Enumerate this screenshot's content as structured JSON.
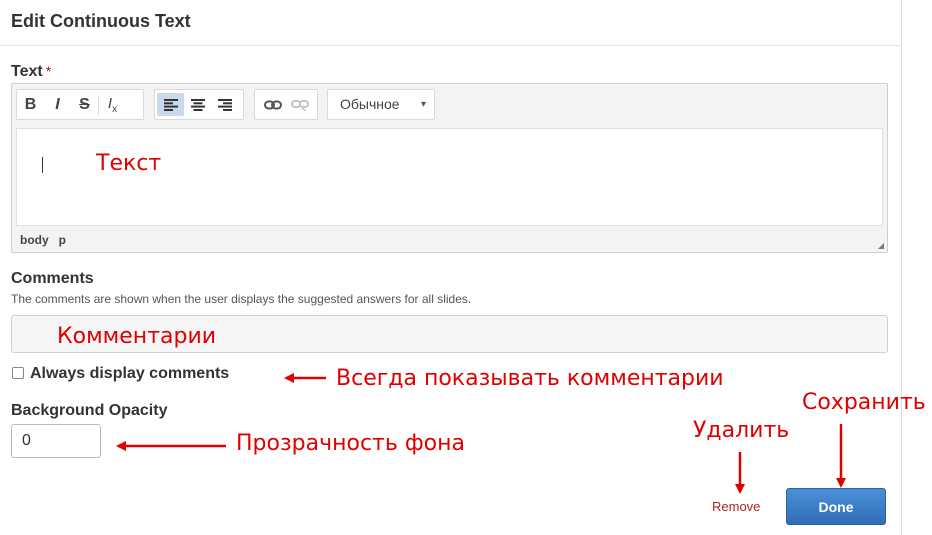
{
  "header": {
    "title": "Edit Continuous Text"
  },
  "text_field": {
    "label": "Text",
    "required_marker": "*",
    "toolbar": {
      "group1": [
        "B",
        "I",
        "S",
        "Ix"
      ],
      "group2_icons": [
        "align-left-icon",
        "align-center-icon",
        "align-right-icon"
      ],
      "group3_icons": [
        "link-icon",
        "unlink-icon"
      ],
      "format_value": "Обычное",
      "format_caret": "▾"
    },
    "path": [
      "body",
      "p"
    ],
    "annotation": "Текст"
  },
  "comments": {
    "label": "Comments",
    "hint": "The comments are shown when the user displays the suggested answers for all slides.",
    "annotation": "Комментарии"
  },
  "always_display": {
    "label": "Always display comments",
    "checked": false,
    "annotation": "Всегда показывать комментарии"
  },
  "background_opacity": {
    "label": "Background Opacity",
    "value": "0",
    "annotation": "Прозрачность фона"
  },
  "actions": {
    "remove_label": "Remove",
    "done_label": "Done",
    "remove_annotation": "Удалить",
    "done_annotation": "Сохранить"
  },
  "colors": {
    "annotation_red": "#e00000",
    "done_blue": "#3a7bc8",
    "remove_red": "#b22222"
  }
}
